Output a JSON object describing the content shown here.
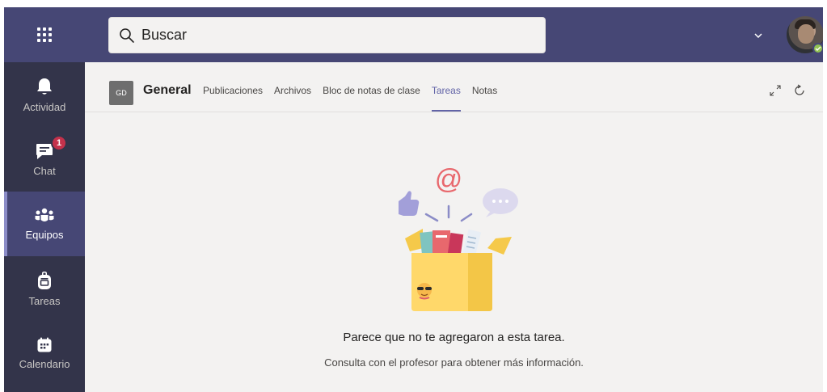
{
  "search": {
    "text": "Buscar"
  },
  "rail": {
    "items": [
      {
        "label": "Actividad"
      },
      {
        "label": "Chat",
        "badge": "1"
      },
      {
        "label": "Equipos"
      },
      {
        "label": "Tareas"
      },
      {
        "label": "Calendario"
      }
    ]
  },
  "header": {
    "team_initials": "GD",
    "team_name": "General",
    "tabs": [
      {
        "label": "Publicaciones"
      },
      {
        "label": "Archivos"
      },
      {
        "label": "Bloc de notas de clase"
      },
      {
        "label": "Tareas"
      },
      {
        "label": "Notas"
      }
    ]
  },
  "empty_state": {
    "title": "Parece que no te agregaron a esta tarea.",
    "subtitle": "Consulta con el profesor para obtener más información."
  },
  "colors": {
    "topbar": "#464775",
    "rail": "#33344a",
    "accent": "#6264a7",
    "badge": "#c4314b",
    "presence": "#92c353"
  }
}
